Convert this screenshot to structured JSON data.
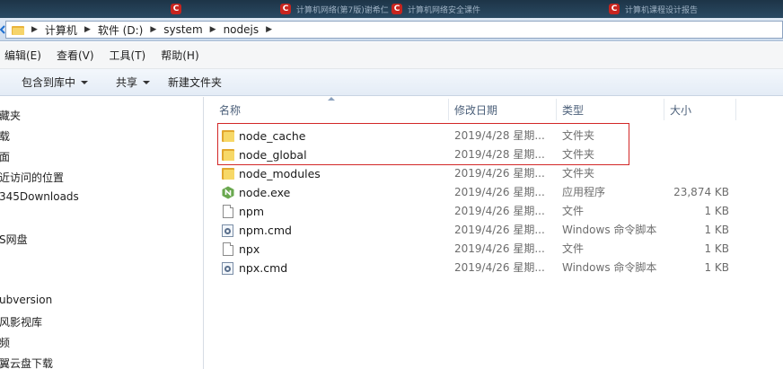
{
  "taskbar": {
    "tasks": [
      {
        "label": ""
      },
      {
        "label": "计算机网络(第7版)谢希仁"
      },
      {
        "label": "计算机网络安全课件"
      },
      {
        "label": "计算机课程设计报告"
      }
    ]
  },
  "address": {
    "crumbs": [
      "计算机",
      "软件 (D:)",
      "system",
      "nodejs"
    ]
  },
  "menu": {
    "items": [
      "编辑(E)",
      "查看(V)",
      "工具(T)",
      "帮助(H)"
    ]
  },
  "toolbar": {
    "include_library": "包含到库中",
    "share": "共享",
    "new_folder": "新建文件夹"
  },
  "nav": {
    "items": [
      "藏夹",
      "载",
      "面",
      "近访问的位置",
      "345Downloads",
      "S网盘",
      "ubversion",
      "风影视库",
      "频",
      "翼云盘下载"
    ]
  },
  "columns": {
    "name": "名称",
    "date": "修改日期",
    "type": "类型",
    "size": "大小"
  },
  "files": [
    {
      "name": "node_cache",
      "date": "2019/4/28 星期...",
      "type": "文件夹",
      "size": "",
      "icon": "folder-icon"
    },
    {
      "name": "node_global",
      "date": "2019/4/28 星期...",
      "type": "文件夹",
      "size": "",
      "icon": "folder-icon"
    },
    {
      "name": "node_modules",
      "date": "2019/4/26 星期...",
      "type": "文件夹",
      "size": "",
      "icon": "folder-icon"
    },
    {
      "name": "node.exe",
      "date": "2019/4/26 星期...",
      "type": "应用程序",
      "size": "23,874 KB",
      "icon": "nodejs-exe-icon"
    },
    {
      "name": "npm",
      "date": "2019/4/26 星期...",
      "type": "文件",
      "size": "1 KB",
      "icon": "file-icon"
    },
    {
      "name": "npm.cmd",
      "date": "2019/4/26 星期...",
      "type": "Windows 命令脚本",
      "size": "1 KB",
      "icon": "cmd-script-icon"
    },
    {
      "name": "npx",
      "date": "2019/4/26 星期...",
      "type": "文件",
      "size": "1 KB",
      "icon": "file-icon"
    },
    {
      "name": "npx.cmd",
      "date": "2019/4/26 星期...",
      "type": "Windows 命令脚本",
      "size": "1 KB",
      "icon": "cmd-script-icon"
    }
  ],
  "colors": {
    "highlight_box": "#d22727",
    "folder": "#f7d867",
    "node_green": "#6aa84f"
  }
}
